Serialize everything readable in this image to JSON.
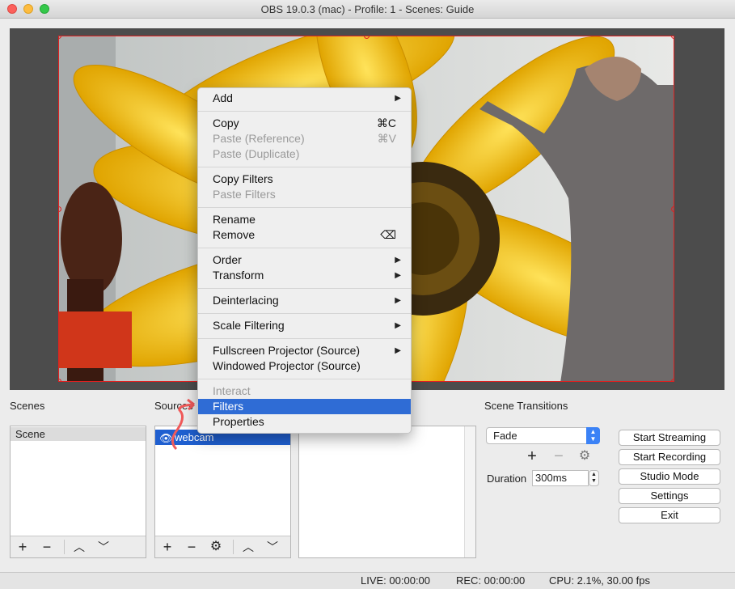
{
  "window": {
    "title": "OBS 19.0.3 (mac) - Profile: 1 - Scenes: Guide"
  },
  "context_menu": {
    "items": [
      {
        "label": "Add",
        "submenu": true
      },
      {
        "label": "Copy",
        "shortcut": "⌘C"
      },
      {
        "label": "Paste (Reference)",
        "shortcut": "⌘V",
        "disabled": true
      },
      {
        "label": "Paste (Duplicate)",
        "disabled": true
      },
      {
        "label": "Copy Filters"
      },
      {
        "label": "Paste Filters",
        "disabled": true
      },
      {
        "label": "Rename"
      },
      {
        "label": "Remove",
        "shortcut": "⌫"
      },
      {
        "label": "Order",
        "submenu": true
      },
      {
        "label": "Transform",
        "submenu": true
      },
      {
        "label": "Deinterlacing",
        "submenu": true
      },
      {
        "label": "Scale Filtering",
        "submenu": true
      },
      {
        "label": "Fullscreen Projector (Source)",
        "submenu": true
      },
      {
        "label": "Windowed Projector (Source)"
      },
      {
        "label": "Interact",
        "disabled": true
      },
      {
        "label": "Filters",
        "highlighted": true
      },
      {
        "label": "Properties"
      }
    ],
    "submenu_arrow": "▶"
  },
  "scenes": {
    "label": "Scenes",
    "items": [
      "Scene"
    ]
  },
  "sources": {
    "label": "Sources",
    "items": [
      "webcam"
    ]
  },
  "toolbar_glyphs": {
    "add": "+",
    "remove": "−",
    "gear": "⚙",
    "up": "︿",
    "down": "﹀"
  },
  "transitions": {
    "label": "Scene Transitions",
    "selected": "Fade",
    "duration_label": "Duration",
    "duration_value": "300ms"
  },
  "controls": {
    "start_streaming": "Start Streaming",
    "start_recording": "Start Recording",
    "studio_mode": "Studio Mode",
    "settings": "Settings",
    "exit": "Exit"
  },
  "status": {
    "live": "LIVE: 00:00:00",
    "rec": "REC: 00:00:00",
    "cpu": "CPU: 2.1%, 30.00 fps"
  },
  "colors": {
    "accent": "#1f5fd0",
    "highlight": "#2f6cd5",
    "bounding_box": "#e02020"
  }
}
